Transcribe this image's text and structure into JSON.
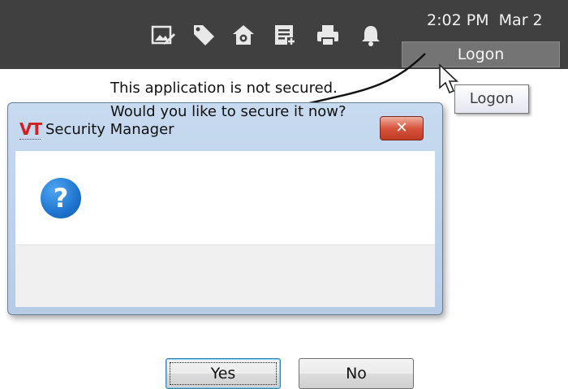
{
  "taskbar": {
    "icons": [
      "image-edit-icon",
      "tag-icon",
      "home-settings-icon",
      "list-add-icon",
      "printer-icon",
      "bell-icon"
    ],
    "time": "2:02 PM",
    "date": "Mar 2",
    "logon_label": "Logon",
    "background": "#404040"
  },
  "tooltip": {
    "text": "Logon"
  },
  "dialog": {
    "logo_text": "VT",
    "title": "Security Manager",
    "close_label": "✕",
    "message_line1": "This application is not secured.",
    "message_line2": "Would you like to secure it now?",
    "icon": "question-icon",
    "yes_label": "Yes",
    "no_label": "No",
    "close_color": "#c23a22",
    "question_color": "#1f74cf"
  }
}
